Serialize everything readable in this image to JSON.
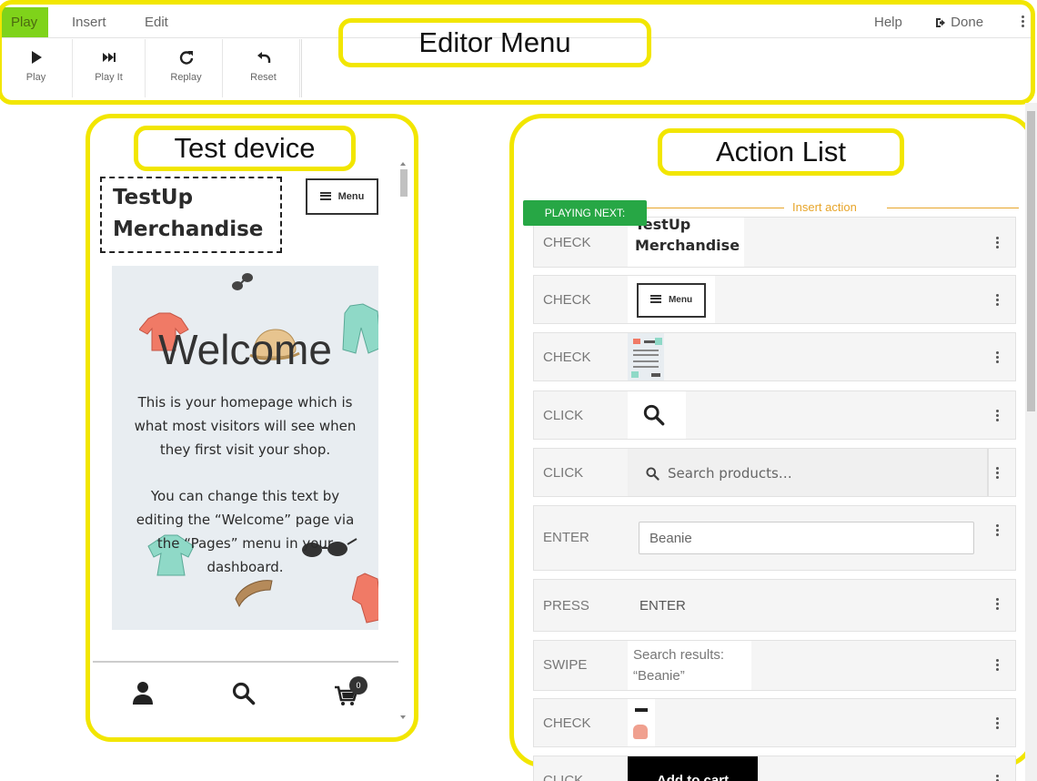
{
  "editor": {
    "annotation": "Editor Menu",
    "tabs": [
      {
        "label": "Play",
        "active": true
      },
      {
        "label": "Insert",
        "active": false
      },
      {
        "label": "Edit",
        "active": false
      }
    ],
    "help_label": "Help",
    "done_label": "Done",
    "tools": [
      {
        "label": "Play",
        "icon": "play-icon"
      },
      {
        "label": "Play It",
        "icon": "fast-forward-icon"
      },
      {
        "label": "Replay",
        "icon": "redo-icon"
      },
      {
        "label": "Reset",
        "icon": "undo-icon"
      }
    ]
  },
  "device": {
    "annotation": "Test device",
    "site_title_line1": "TestUp",
    "site_title_line2": "Merchandise",
    "menu_label": "Menu",
    "hero_title": "Welcome",
    "hero_paragraph1": [
      "This is your homepage which is",
      "what most visitors will see when",
      "they first visit your shop."
    ],
    "hero_paragraph2": [
      "You can change this text by",
      "editing the “Welcome” page via",
      "the “Pages” menu in your",
      "dashboard."
    ],
    "cart_count": "0"
  },
  "action_list": {
    "annotation": "Action List",
    "playing_next_label": "PLAYING NEXT:",
    "insert_action_label": "Insert action",
    "search_placeholder": "Search products…",
    "enter_value": "Beanie",
    "press_key": "ENTER",
    "swipe_text_line1": "Search results:",
    "swipe_text_line2": "“Beanie”",
    "add_to_cart_label": "Add to cart",
    "actions": [
      "CHECK",
      "CHECK",
      "CHECK",
      "CLICK",
      "CLICK",
      "ENTER",
      "PRESS",
      "SWIPE",
      "CHECK",
      "CLICK"
    ]
  },
  "colors": {
    "highlight": "#f2e600",
    "active_tab": "#7fd31a",
    "playing_next": "#27a745",
    "insert_action": "#e7a52a"
  }
}
